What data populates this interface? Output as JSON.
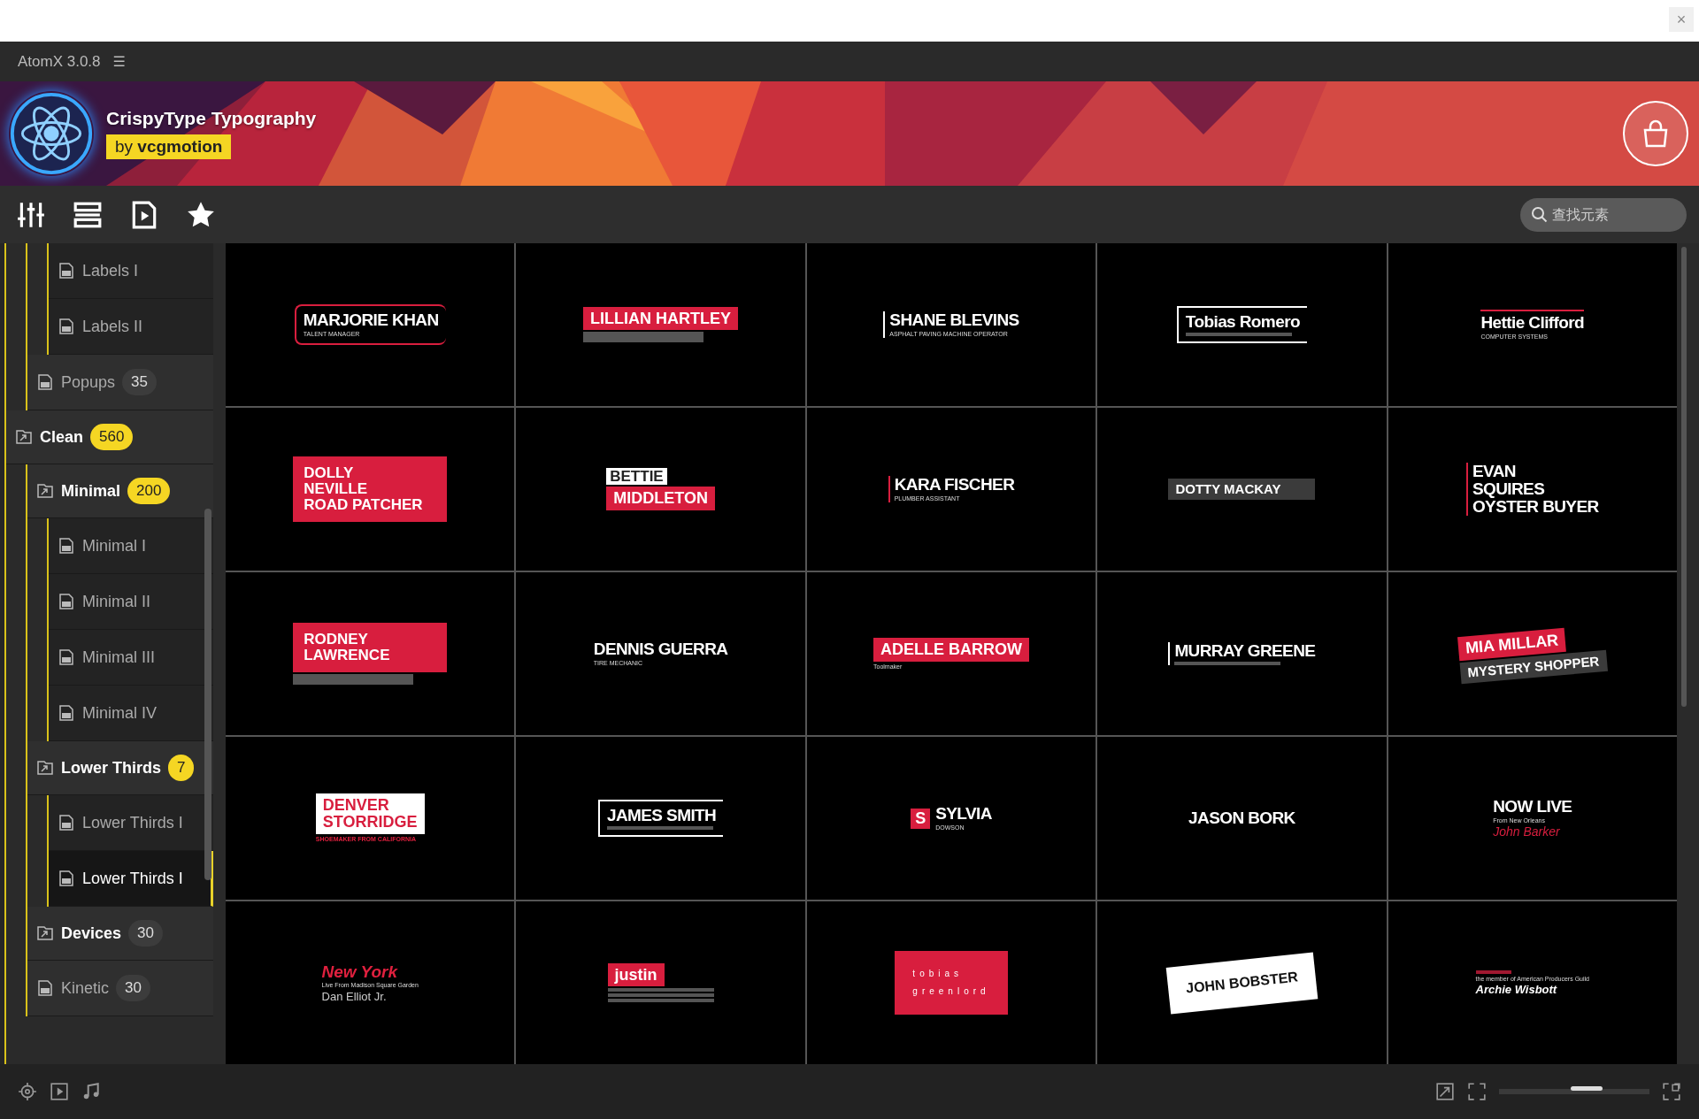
{
  "top_strip": {
    "close_glyph": "×"
  },
  "window": {
    "title": "AtomX 3.0.8",
    "menu_glyph": "☰"
  },
  "banner": {
    "title": "CrispyType Typography",
    "byline": "by **vcgmotion**"
  },
  "search": {
    "placeholder": "查找元素"
  },
  "tree": [
    {
      "children": [
        {
          "children": [
            {
              "kind": "file",
              "label": "Labels I",
              "selected": false
            },
            {
              "kind": "file",
              "label": "Labels II",
              "selected": false
            }
          ]
        },
        {
          "kind": "file",
          "label": "Popups",
          "count": "35",
          "selected": false
        }
      ]
    },
    {
      "kind": "folder",
      "label": "Clean",
      "count": "560",
      "expanded": true,
      "children": [
        {
          "kind": "folder",
          "label": "Minimal",
          "count": "200",
          "expanded": true,
          "children": [
            {
              "kind": "file",
              "label": "Minimal I",
              "selected": false
            },
            {
              "kind": "file",
              "label": "Minimal II",
              "selected": false
            },
            {
              "kind": "file",
              "label": "Minimal III",
              "selected": false
            },
            {
              "kind": "file",
              "label": "Minimal IV",
              "selected": false
            }
          ]
        },
        {
          "kind": "folder",
          "label": "Lower Thirds",
          "count": "7",
          "expanded": true,
          "children": [
            {
              "kind": "file",
              "label": "Lower Thirds I",
              "selected": false
            },
            {
              "kind": "file",
              "label": "Lower Thirds I",
              "selected": true
            }
          ]
        },
        {
          "kind": "folder",
          "label": "Devices",
          "count": "30",
          "expanded": false
        },
        {
          "kind": "file",
          "label": "Kinetic",
          "count": "30",
          "selected": false
        }
      ]
    }
  ],
  "thumbnails": [
    {
      "kind": "outline-red",
      "lines": [
        {
          "kind": "name",
          "text": "MARJORIE KHAN"
        },
        {
          "kind": "sub",
          "text": "TALENT MANAGER"
        }
      ]
    },
    {
      "lines": [
        {
          "kind": "red-band",
          "text": "LILLIAN HARTLEY"
        },
        {
          "kind": "grey-band"
        }
      ]
    },
    {
      "kind": "left-rule",
      "lines": [
        {
          "kind": "name",
          "text": "SHANE BLEVINS"
        },
        {
          "kind": "sub",
          "text": "ASPHALT PAVING MACHINE OPERATOR"
        }
      ]
    },
    {
      "kind": "outline",
      "lines": [
        {
          "kind": "name",
          "text": "Tobias Romero"
        },
        {
          "kind": "blur"
        }
      ]
    },
    {
      "kind": "top-rule",
      "lines": [
        {
          "kind": "name",
          "text": "Hettie Clifford"
        },
        {
          "kind": "sub",
          "text": "COMPUTER SYSTEMS"
        }
      ]
    },
    {
      "lines": [
        {
          "kind": "red-block",
          "text": "DOLLY\nNEVILLE\nROAD PATCHER"
        }
      ]
    },
    {
      "lines": [
        {
          "kind": "white-band",
          "text": "BETTIE"
        },
        {
          "kind": "red-band",
          "text": "MIDDLETON"
        }
      ]
    },
    {
      "kind": "left-rule-red",
      "lines": [
        {
          "kind": "name",
          "text": "KARA FISCHER"
        },
        {
          "kind": "sub",
          "text": "PLUMBER ASSISTANT"
        }
      ]
    },
    {
      "lines": [
        {
          "kind": "grey-band",
          "text": "DOTTY MACKAY"
        }
      ]
    },
    {
      "kind": "left-rule-red",
      "lines": [
        {
          "kind": "name",
          "text": "EVAN\nSQUIRES\nOYSTER BUYER"
        }
      ]
    },
    {
      "lines": [
        {
          "kind": "red-block",
          "text": "RODNEY\nLAWRENCE"
        },
        {
          "kind": "grey-band"
        }
      ]
    },
    {
      "lines": [
        {
          "kind": "name",
          "text": "DENNIS GUERRA"
        },
        {
          "kind": "sub",
          "text": "TIRE MECHANIC"
        }
      ]
    },
    {
      "lines": [
        {
          "kind": "red-band",
          "text": "ADELLE BARROW"
        },
        {
          "kind": "sub",
          "text": "Toolmaker"
        }
      ]
    },
    {
      "kind": "left-rule",
      "lines": [
        {
          "kind": "name",
          "text": "MURRAY GREENE"
        },
        {
          "kind": "blur"
        }
      ]
    },
    {
      "kind": "tilt",
      "lines": [
        {
          "kind": "red-band",
          "text": "MIA MILLAR"
        },
        {
          "kind": "grey-band",
          "text": "MYSTERY SHOPPER"
        }
      ]
    },
    {
      "lines": [
        {
          "kind": "white-block",
          "text": "DENVER\nSTORRIDGE"
        },
        {
          "kind": "red-sub",
          "text": "SHOEMAKER FROM CALIFORNIA"
        }
      ]
    },
    {
      "kind": "outline",
      "lines": [
        {
          "kind": "name",
          "text": "JAMES SMITH"
        },
        {
          "kind": "blur"
        }
      ]
    },
    {
      "lead": "S",
      "lines": [
        {
          "kind": "name",
          "text": "SYLVIA"
        },
        {
          "kind": "sub",
          "text": "DOWSON"
        }
      ]
    },
    {
      "lines": [
        {
          "kind": "name",
          "text": "JASON BORK"
        }
      ]
    },
    {
      "lines": [
        {
          "kind": "name",
          "text": "NOW LIVE"
        },
        {
          "kind": "sub",
          "text": "From New Orleans"
        },
        {
          "kind": "script-red",
          "text": "John Barker"
        }
      ]
    },
    {
      "lines": [
        {
          "kind": "red",
          "text": "New York"
        },
        {
          "kind": "sub",
          "text": "Live From Madison Square Garden"
        },
        {
          "kind": "light",
          "text": "Dan Elliot Jr."
        }
      ]
    },
    {
      "lines": [
        {
          "kind": "red-band",
          "text": "justin"
        },
        {
          "kind": "blur"
        },
        {
          "kind": "blur"
        },
        {
          "kind": "blur"
        }
      ]
    },
    {
      "lines": [
        {
          "kind": "red-card",
          "text": "tobias\ngreenlord"
        }
      ]
    },
    {
      "kind": "tilt-back",
      "lines": [
        {
          "kind": "white-card",
          "text": "JOHN BOBSTER"
        }
      ]
    },
    {
      "lines": [
        {
          "kind": "red-blur"
        },
        {
          "kind": "sub",
          "text": "the member of American Producers Guild"
        },
        {
          "kind": "italic",
          "text": "Archie Wisbott"
        }
      ]
    }
  ],
  "zoom_slider": {
    "level": 0.58
  }
}
